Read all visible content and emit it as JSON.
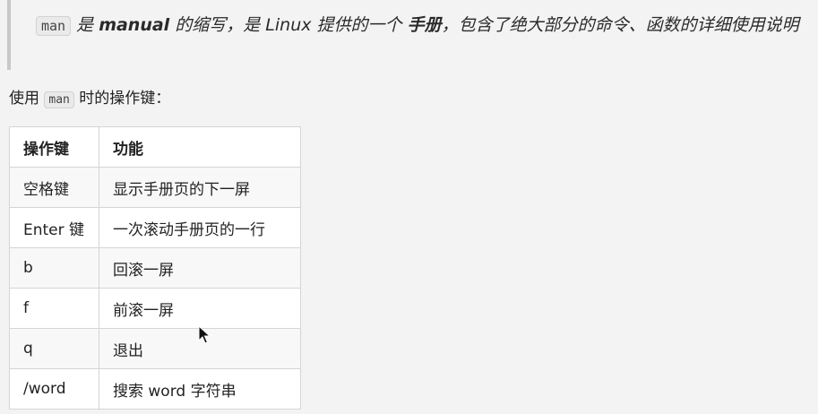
{
  "quote": {
    "code": "man",
    "part1": " 是 ",
    "bold1": "manual",
    "part2": " 的缩写，是 Linux 提供的一个 ",
    "bold2": "手册",
    "part3": "，包含了绝大部分的命令、函数的详细使用说明"
  },
  "intro": {
    "before": "使用 ",
    "code": "man",
    "after": " 时的操作键："
  },
  "table": {
    "headers": [
      "操作键",
      "功能"
    ],
    "rows": [
      [
        "空格键",
        "显示手册页的下一屏"
      ],
      [
        "Enter 键",
        "一次滚动手册页的一行"
      ],
      [
        "b",
        "回滚一屏"
      ],
      [
        "f",
        "前滚一屏"
      ],
      [
        "q",
        "退出"
      ],
      [
        "/word",
        "搜索 word 字符串"
      ]
    ]
  },
  "icons": {
    "cursor": "mouse-pointer-icon"
  }
}
